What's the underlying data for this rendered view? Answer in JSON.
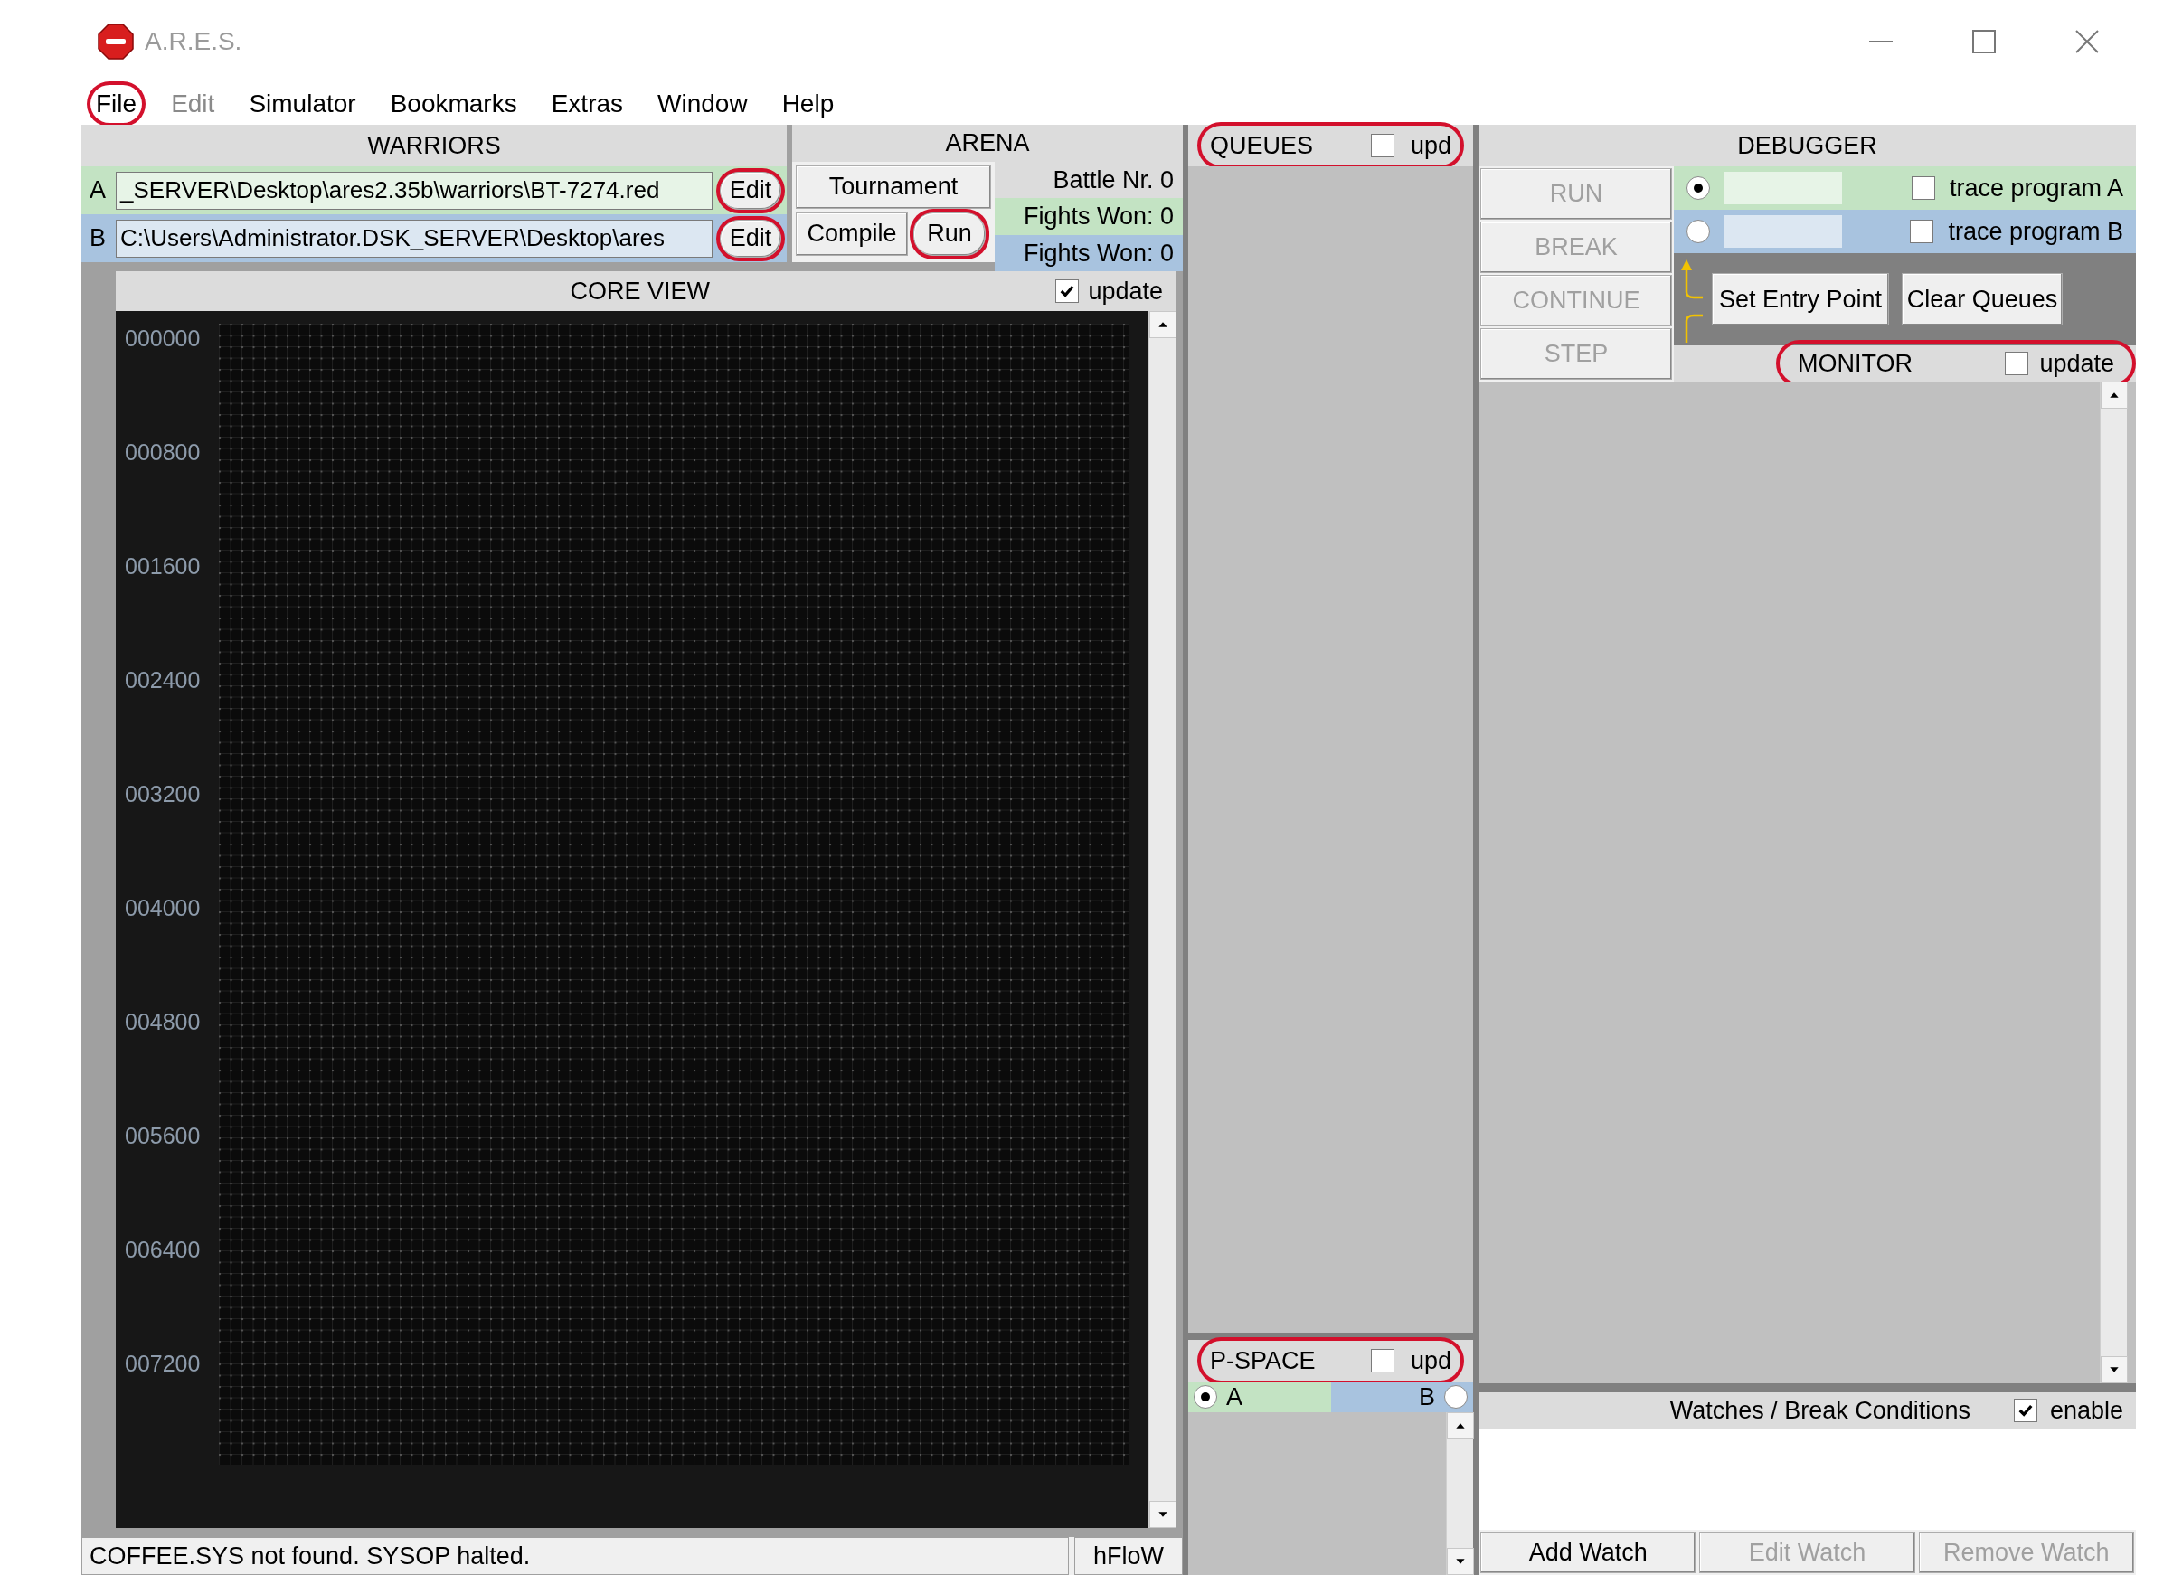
{
  "window": {
    "title": "A.R.E.S."
  },
  "menu": [
    {
      "label": "File",
      "disabled": false,
      "highlighted": true
    },
    {
      "label": "Edit",
      "disabled": true,
      "highlighted": false
    },
    {
      "label": "Simulator",
      "disabled": false,
      "highlighted": false
    },
    {
      "label": "Bookmarks",
      "disabled": false,
      "highlighted": false
    },
    {
      "label": "Extras",
      "disabled": false,
      "highlighted": false
    },
    {
      "label": "Window",
      "disabled": false,
      "highlighted": false
    },
    {
      "label": "Help",
      "disabled": false,
      "highlighted": false
    }
  ],
  "warriors": {
    "title": "WARRIORS",
    "rows": [
      {
        "letter": "A",
        "path": "_SERVER\\Desktop\\ares2.35b\\warriors\\BT-7274.red",
        "button": "Edit",
        "highlighted": true,
        "color": "#c3e3c3"
      },
      {
        "letter": "B",
        "path": "C:\\Users\\Administrator.DSK_SERVER\\Desktop\\ares",
        "button": "Edit",
        "highlighted": true,
        "color": "#a8c3df"
      }
    ]
  },
  "arena": {
    "title": "ARENA",
    "buttons": [
      {
        "label": "Tournament",
        "highlighted": false
      },
      {
        "label": "Compile",
        "highlighted": false
      },
      {
        "label": "Run",
        "highlighted": true
      }
    ],
    "stats": [
      {
        "text": "Battle Nr. 0",
        "color": "#dcdcdc"
      },
      {
        "text": "Fights Won: 0",
        "color": "#c3e3c3"
      },
      {
        "text": "Fights Won: 0",
        "color": "#a8c3df"
      }
    ]
  },
  "core_view": {
    "title": "CORE VIEW",
    "update": {
      "label": "update",
      "checked": true
    },
    "addresses": [
      "000000",
      "000800",
      "001600",
      "002400",
      "003200",
      "004000",
      "004800",
      "005600",
      "006400",
      "007200"
    ]
  },
  "status_bar": {
    "message": "COFFEE.SYS not found. SYSOP halted.",
    "mode": "hFloW"
  },
  "queues": {
    "title": "QUEUES",
    "highlighted": true,
    "update": {
      "label": "upd",
      "checked": false
    }
  },
  "pspace": {
    "title": "P-SPACE",
    "highlighted": true,
    "update": {
      "label": "upd",
      "checked": false
    },
    "programs": [
      {
        "label": "A",
        "selected": true,
        "color": "#c3e3c3"
      },
      {
        "label": "B",
        "selected": false,
        "color": "#a8c3df"
      }
    ]
  },
  "debugger": {
    "title": "DEBUGGER",
    "buttons": [
      {
        "label": "RUN",
        "disabled": true
      },
      {
        "label": "BREAK",
        "disabled": true
      },
      {
        "label": "CONTINUE",
        "disabled": true
      },
      {
        "label": "STEP",
        "disabled": true
      }
    ],
    "programs": [
      {
        "selected": true,
        "color": "#c3e3c3",
        "trace": {
          "label": "trace program A",
          "checked": false
        }
      },
      {
        "selected": false,
        "color": "#a8c3df",
        "trace": {
          "label": "trace program B",
          "checked": false
        }
      }
    ],
    "actions": [
      {
        "label": "Set Entry Point"
      },
      {
        "label": "Clear Queues"
      }
    ]
  },
  "monitor": {
    "title": "MONITOR",
    "highlighted": true,
    "update": {
      "label": "update",
      "checked": false
    }
  },
  "watches": {
    "title": "Watches / Break Conditions",
    "enable": {
      "label": "enable",
      "checked": true
    },
    "buttons": [
      {
        "label": "Add Watch",
        "disabled": false
      },
      {
        "label": "Edit Watch",
        "disabled": true
      },
      {
        "label": "Remove Watch",
        "disabled": true
      }
    ]
  }
}
